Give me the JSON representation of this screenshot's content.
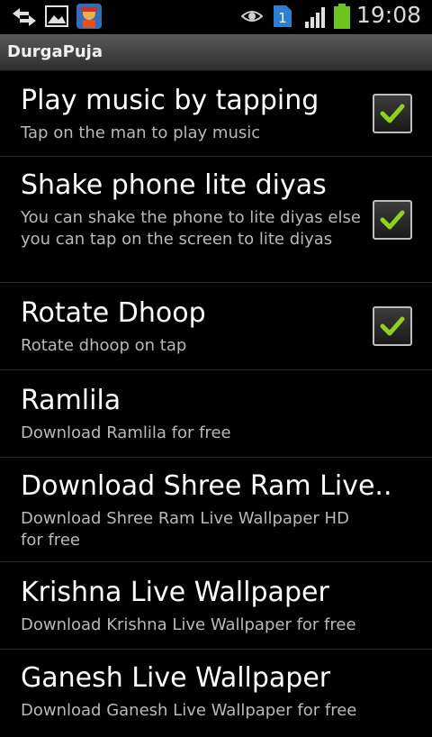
{
  "status_bar": {
    "time": "19:08",
    "sim_badge": "1",
    "icons": [
      "data-transfer-icon",
      "gallery-icon",
      "app-notification-icon",
      "eye-icon",
      "sim-1-icon",
      "signal-icon",
      "battery-icon"
    ],
    "battery_color": "#6cc51f"
  },
  "app": {
    "title": "DurgaPuja"
  },
  "accent": {
    "checkmark": "#8fd11d"
  },
  "settings": [
    {
      "title": "Play music by tapping",
      "summary": "Tap on the man to play music",
      "checked": true
    },
    {
      "title": "Shake phone lite diyas",
      "summary": "You can shake the phone to lite diyas else you can tap on the screen to lite diyas",
      "checked": true
    },
    {
      "title": "Rotate Dhoop",
      "summary": "Rotate dhoop on tap",
      "checked": true
    },
    {
      "title": "Ramlila",
      "summary": "Download Ramlila for free"
    },
    {
      "title": "Download Shree Ram Live..",
      "summary": "Download Shree Ram Live Wallpaper HD for free"
    },
    {
      "title": "Krishna Live Wallpaper",
      "summary": "Download Krishna Live Wallpaper for free"
    },
    {
      "title": "Ganesh Live Wallpaper",
      "summary": "Download Ganesh Live Wallpaper for free"
    }
  ]
}
